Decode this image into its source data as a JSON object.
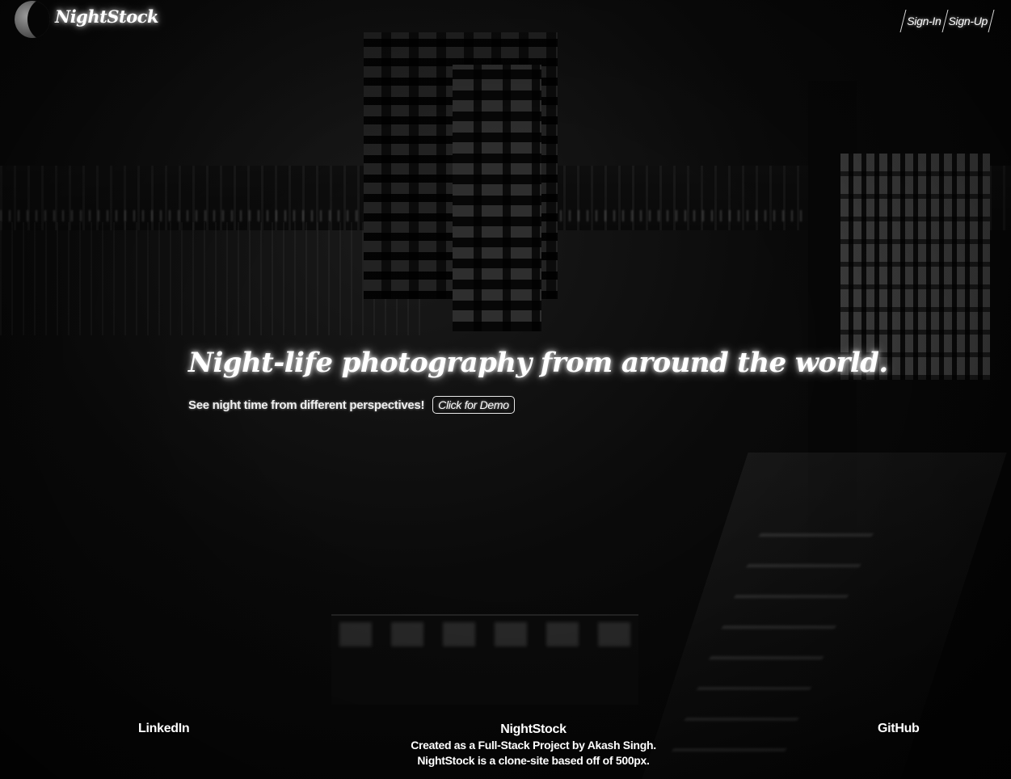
{
  "header": {
    "brand": "NightStock",
    "auth": {
      "sign_in": "Sign-In",
      "sign_up": "Sign-Up"
    }
  },
  "hero": {
    "title": "Night-life photography from around the world.",
    "tagline": "See night time from different perspectives!",
    "demo_button": "Click for Demo"
  },
  "footer": {
    "linkedin": "LinkedIn",
    "brand": "NightStock",
    "credit": "Created as a Full-Stack Project by Akash Singh.",
    "note": "NightStock is a clone-site based off of 500px.",
    "github": "GitHub"
  },
  "icons": {
    "logo": "moon-icon"
  },
  "colors": {
    "background": "#000000",
    "text": "#ffffff",
    "glow": "#ffffff"
  }
}
